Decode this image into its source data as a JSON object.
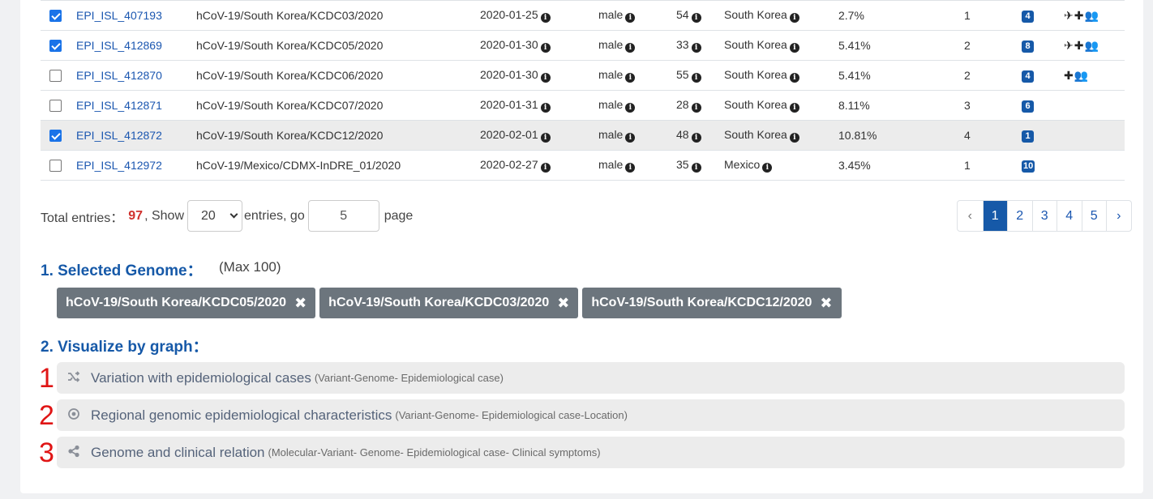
{
  "table": {
    "rows": [
      {
        "checked": true,
        "id": "EPI_ISL_407193",
        "name": "hCoV-19/South Korea/KCDC03/2020",
        "date": "2020-01-25",
        "sex": "male",
        "age": "54",
        "location": "South Korea",
        "percent": "2.7%",
        "count": "1",
        "badge": "4",
        "flags": "✈✚👥"
      },
      {
        "checked": true,
        "id": "EPI_ISL_412869",
        "name": "hCoV-19/South Korea/KCDC05/2020",
        "date": "2020-01-30",
        "sex": "male",
        "age": "33",
        "location": "South Korea",
        "percent": "5.41%",
        "count": "2",
        "badge": "8",
        "flags": "✈✚👥"
      },
      {
        "checked": false,
        "id": "EPI_ISL_412870",
        "name": "hCoV-19/South Korea/KCDC06/2020",
        "date": "2020-01-30",
        "sex": "male",
        "age": "55",
        "location": "South Korea",
        "percent": "5.41%",
        "count": "2",
        "badge": "4",
        "flags": "✚👥"
      },
      {
        "checked": false,
        "id": "EPI_ISL_412871",
        "name": "hCoV-19/South Korea/KCDC07/2020",
        "date": "2020-01-31",
        "sex": "male",
        "age": "28",
        "location": "South Korea",
        "percent": "8.11%",
        "count": "3",
        "badge": "6",
        "flags": ""
      },
      {
        "checked": true,
        "id": "EPI_ISL_412872",
        "name": "hCoV-19/South Korea/KCDC12/2020",
        "date": "2020-02-01",
        "sex": "male",
        "age": "48",
        "location": "South Korea",
        "percent": "10.81%",
        "count": "4",
        "badge": "1",
        "flags": "",
        "selected": true
      },
      {
        "checked": false,
        "id": "EPI_ISL_412972",
        "name": "hCoV-19/Mexico/CDMX-InDRE_01/2020",
        "date": "2020-02-27",
        "sex": "male",
        "age": "35",
        "location": "Mexico",
        "percent": "3.45%",
        "count": "1",
        "badge": "10",
        "flags": ""
      }
    ]
  },
  "controls": {
    "total_label": "Total entries：",
    "total_value": "97",
    "show_label": ", Show",
    "page_size": "20",
    "entries_go_label": "entries, go",
    "go_value": "5",
    "page_label": "page"
  },
  "pager": {
    "prev": "‹",
    "pages": [
      "1",
      "2",
      "3",
      "4",
      "5"
    ],
    "next": "›",
    "active": "1"
  },
  "selected_genome": {
    "title": "1. Selected Genome：",
    "note": "(Max 100)",
    "tags": [
      "hCoV-19/South Korea/KCDC05/2020",
      "hCoV-19/South Korea/KCDC03/2020",
      "hCoV-19/South Korea/KCDC12/2020"
    ],
    "remove_glyph": "✖"
  },
  "visualize": {
    "title": "2. Visualize by graph：",
    "items": [
      {
        "marker": "1",
        "icon": "shuffle-icon",
        "label": "Variation with epidemiological cases",
        "sub": "(Variant-Genome- Epidemiological case)"
      },
      {
        "marker": "2",
        "icon": "dot-circle-icon",
        "label": "Regional genomic epidemiological characteristics",
        "sub": "(Variant-Genome- Epidemiological case-Location)"
      },
      {
        "marker": "3",
        "icon": "share-nodes-icon",
        "label": "Genome and clinical relation",
        "sub": "(Molecular-Variant- Genome- Epidemiological case- Clinical symptoms)"
      }
    ]
  }
}
